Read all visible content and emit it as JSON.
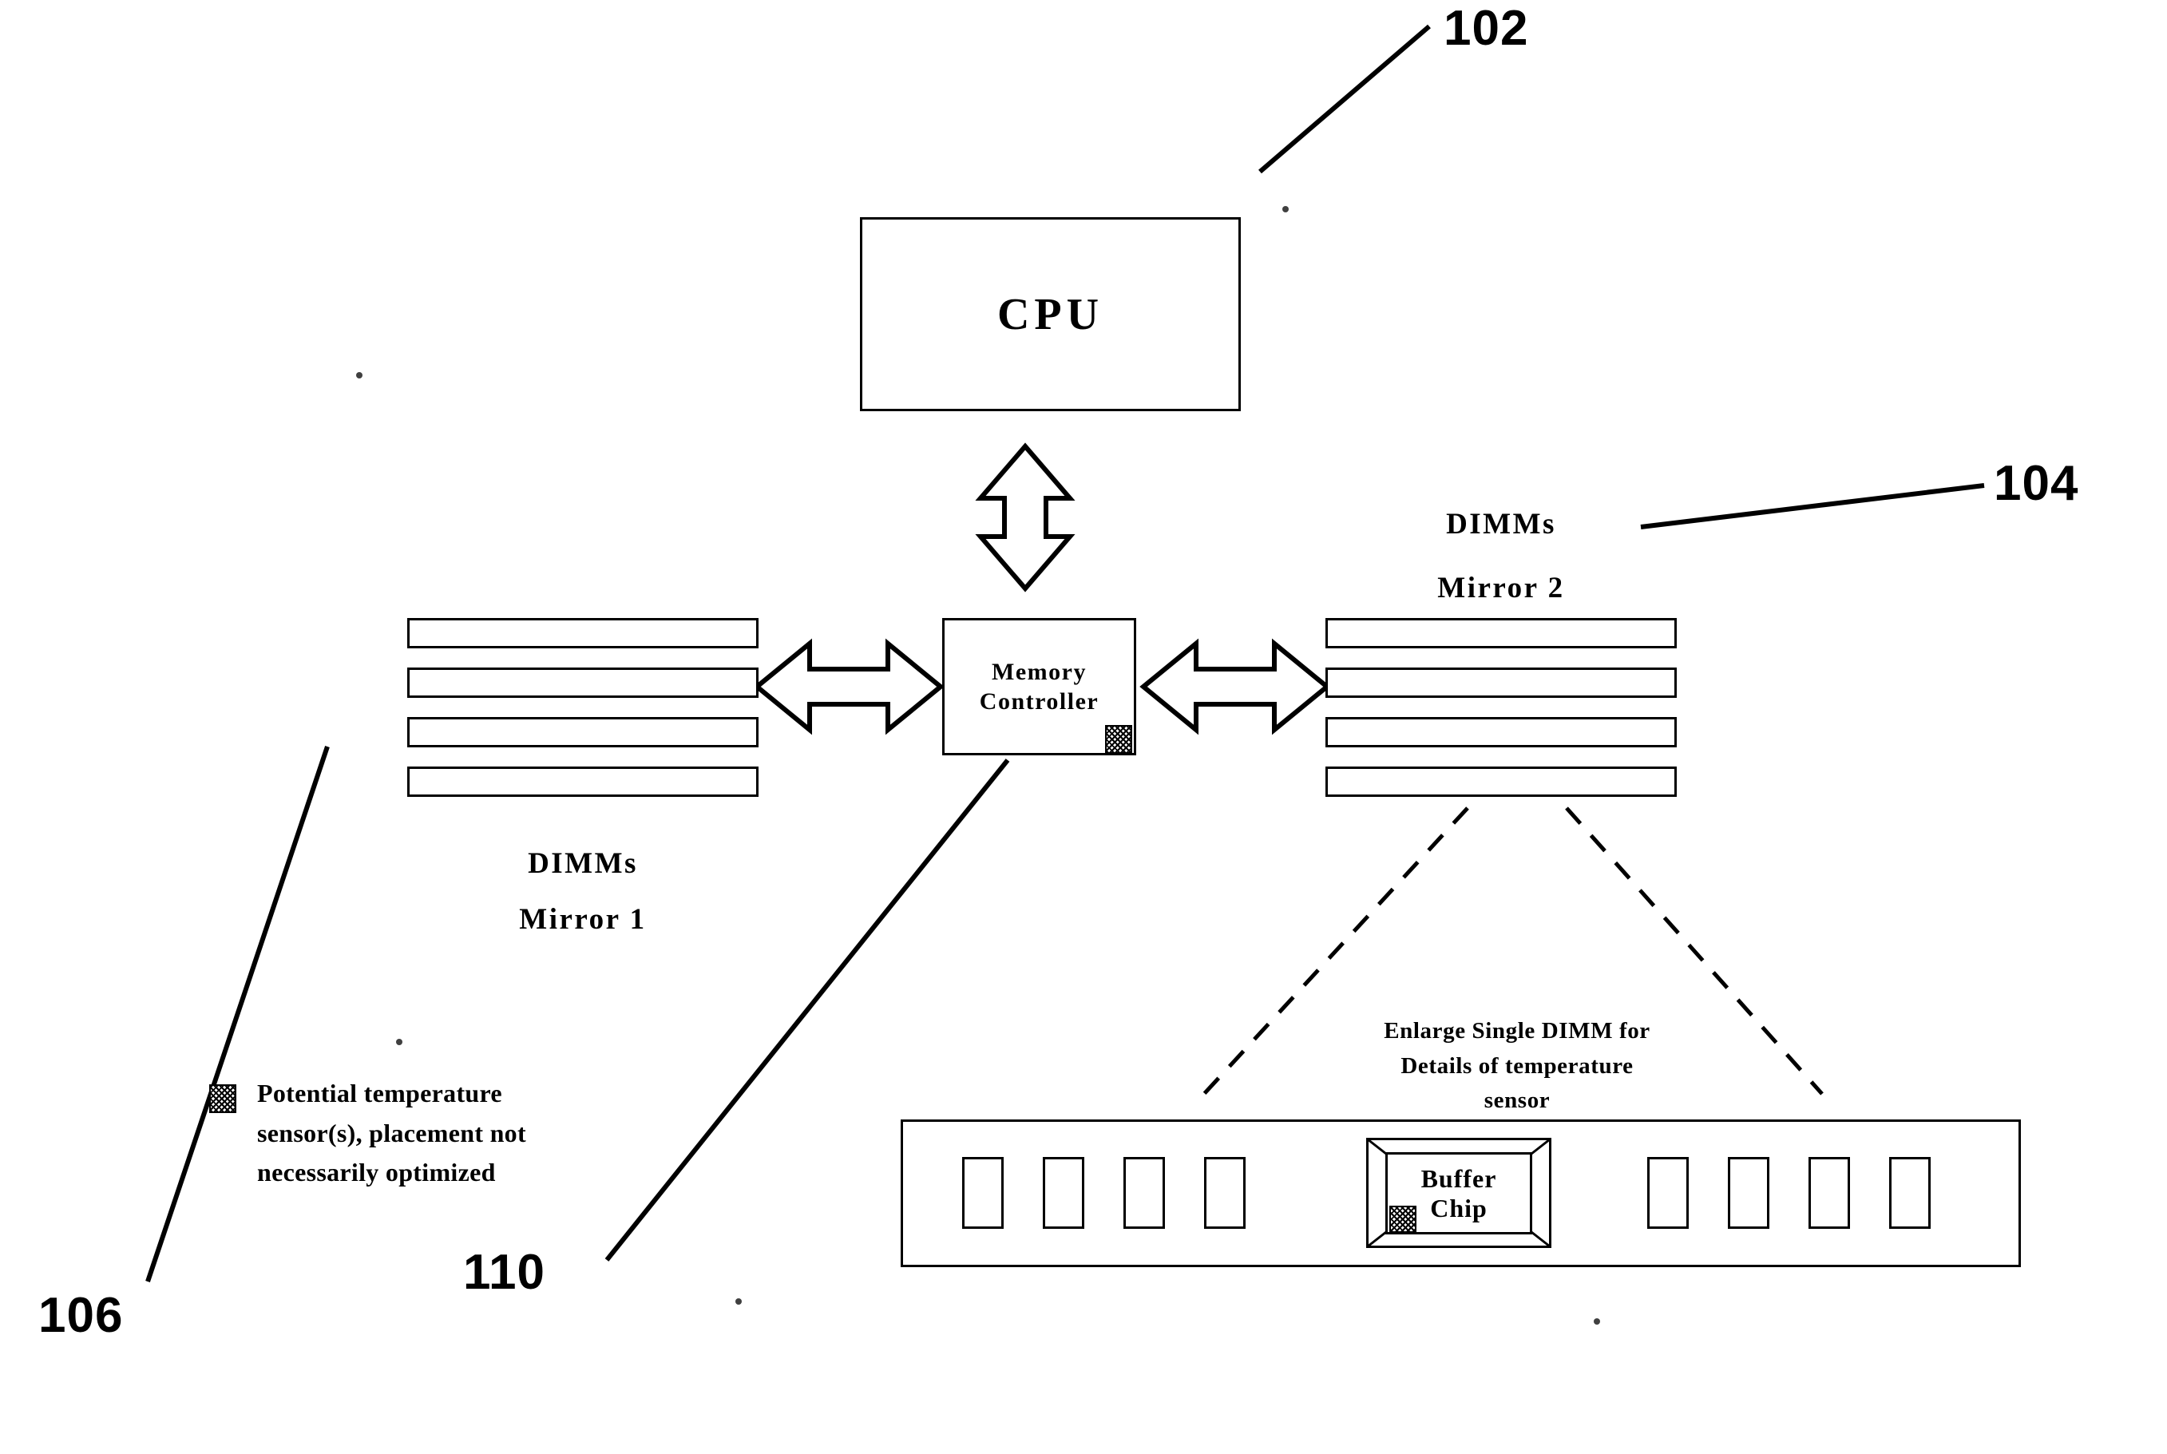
{
  "figure": {
    "ref_102": "102",
    "ref_104": "104",
    "ref_106": "106",
    "ref_110": "110"
  },
  "cpu": {
    "label": "CPU"
  },
  "memory_controller": {
    "line1": "Memory",
    "line2": "Controller"
  },
  "mirror1": {
    "title_line1": "DIMMs",
    "title_line2": "Mirror 1",
    "bar_count": 4
  },
  "mirror2": {
    "title_line1": "DIMMs",
    "title_line2": "Mirror 2",
    "bar_count": 4
  },
  "enlarge_note": {
    "line1": "Enlarge Single DIMM for",
    "line2": "Details of  temperature",
    "line3": "sensor"
  },
  "legend": {
    "line1": "Potential temperature",
    "line2": "sensor(s), placement not",
    "line3": "necessarily optimized",
    "swatch_name": "hatched-sensor-swatch"
  },
  "enlarged_dimm": {
    "buffer_line1": "Buffer",
    "buffer_line2": "Chip",
    "left_chip_count": 4,
    "right_chip_count": 4
  },
  "colors": {
    "stroke": "#000000",
    "fill": "#ffffff"
  }
}
